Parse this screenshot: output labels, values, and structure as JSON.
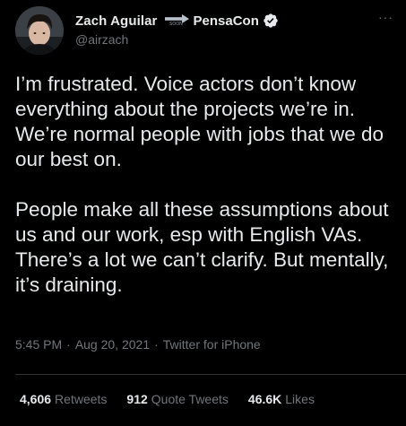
{
  "author": {
    "display_name": "Zach Aguilar",
    "name_suffix": "PensaCon",
    "soon_emoji_text": "SOON",
    "handle": "@airzach",
    "verified_icon": "verified-badge-icon"
  },
  "tweet": {
    "text": "I’m frustrated. Voice actors don’t know everything about the projects we’re in. We’re normal people with jobs that we do our best on.\n\nPeople make all these assumptions about us and our work, esp with English VAs. There’s a lot we can’t clarify. But mentally, it’s draining.",
    "time": "5:45 PM",
    "date": "Aug 20, 2021",
    "source": "Twitter for iPhone",
    "separator": "·"
  },
  "stats": {
    "retweets_count": "4,606",
    "retweets_label": "Retweets",
    "quote_count": "912",
    "quote_label": "Quote Tweets",
    "likes_count": "46.6K",
    "likes_label": "Likes"
  },
  "more_label": "···",
  "colors": {
    "background": "#000000",
    "text": "#e7e9ea",
    "secondary": "#71767b",
    "divider": "#2f3336",
    "verified": "#1d9bf0"
  }
}
